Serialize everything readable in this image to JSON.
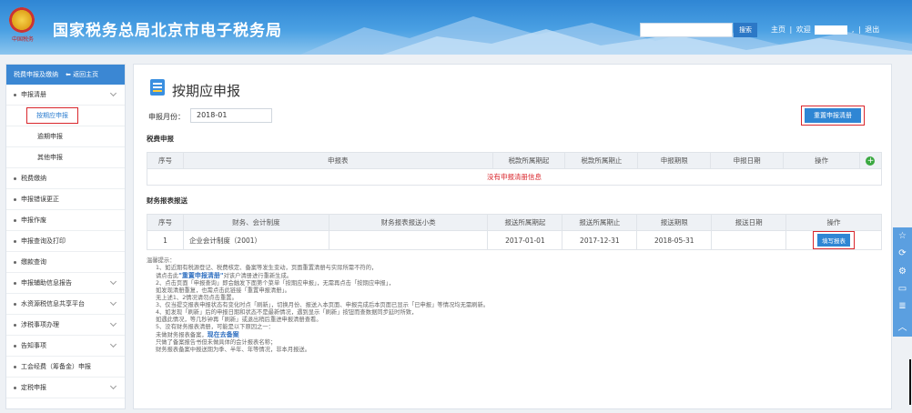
{
  "header": {
    "emblem_text": "中国税务",
    "title": "国家税务总局北京市电子税务局",
    "search_button": "搜索",
    "nav": [
      "主页",
      "|",
      "欢迎",
      ",",
      "|",
      "退出"
    ]
  },
  "sidebar": {
    "head_label": "税费申报及缴纳",
    "back_label": "返回主页",
    "items": [
      {
        "label": "申报清册",
        "has_chevron": true
      },
      {
        "label": "税费缴纳",
        "has_chevron": false
      },
      {
        "label": "申报错误更正",
        "has_chevron": false
      },
      {
        "label": "申报作废",
        "has_chevron": false
      },
      {
        "label": "申报查询及打印",
        "has_chevron": false
      },
      {
        "label": "缴款查询",
        "has_chevron": false
      },
      {
        "label": "申报辅助信息报告",
        "has_chevron": true
      },
      {
        "label": "水资源税信息共享平台",
        "has_chevron": true
      },
      {
        "label": "涉税事项办理",
        "has_chevron": true
      },
      {
        "label": "告知事项",
        "has_chevron": true
      },
      {
        "label": "工会经费（筹备金）申报",
        "has_chevron": false
      },
      {
        "label": "定税申报",
        "has_chevron": true
      }
    ],
    "sub_items": [
      "按期应申报",
      "逾期申报",
      "其他申报"
    ],
    "active_sub": "按期应申报"
  },
  "main": {
    "page_title": "按期应申报",
    "period_label": "申报月份：",
    "period_value": "2018-01",
    "reset_button": "重置申报清册",
    "tax_section": "税费申报",
    "tax_headers": [
      "序号",
      "申报表",
      "税款所属期起",
      "税款所属期止",
      "申报期限",
      "申报日期",
      "操作"
    ],
    "tax_empty": "没有申报清册信息",
    "fin_section": "财务报表报送",
    "fin_headers": [
      "序号",
      "财务、会计制度",
      "财务报表报送小类",
      "报送所属期起",
      "报送所属期止",
      "报送期限",
      "报送日期",
      "操作"
    ],
    "fin_rows": [
      {
        "no": "1",
        "system": "企业会计制度（2001）",
        "subtype": "",
        "start": "2017-01-01",
        "end": "2017-12-31",
        "deadline": "2018-05-31",
        "date": "",
        "action": "填写报表"
      }
    ]
  },
  "tips": {
    "title": "温馨提示：",
    "l1": "1、如近期有税源登记、税费核定、备案等发生变动，页面重置清册与实际所需不符的，",
    "l2a": "请点击此",
    "l2b": "\"重置申报清册\"",
    "l2c": "对该户清册进行重新生成。",
    "l3": "2、点击页面「申报查询」即会触发下面第个菜单「按期应申报」，无需再点击「按期应申报」，",
    "l4": "如发现清册重复，也需点击此链接「重置申报清册」。",
    "l5": "无上述1、2情况请勿点击重置。",
    "l6": "3、仅当提交报表申报状态有变化时点「刷新」，切换月份、报送入本页面、申报完成后本页面已显示「已申报」等情况均无需刷新。",
    "l7": "4、如发现「刷新」后的申报日期和状态不是最新情况，遇到显示「刷新」按钮而查数据同步延时所致，",
    "l8": "如遇此情况，等几秒钟再「刷新」或退出稍后重进申报清册查看。",
    "l9": "5、没有财务报表清册，可能是以下原因之一：",
    "l10a": "未做财务报表备案，",
    "l10b": "现在去备案",
    "l11": "只做了备案报告书但未做具体的会计报表名称；",
    "l12": "财务报表备案中报送期为季、半年、年等情况，非本月报送。"
  },
  "right_bar": {
    "icons": [
      "star-icon",
      "share-icon",
      "settings-icon",
      "chat-icon",
      "menu-icon",
      "up-icon"
    ]
  }
}
